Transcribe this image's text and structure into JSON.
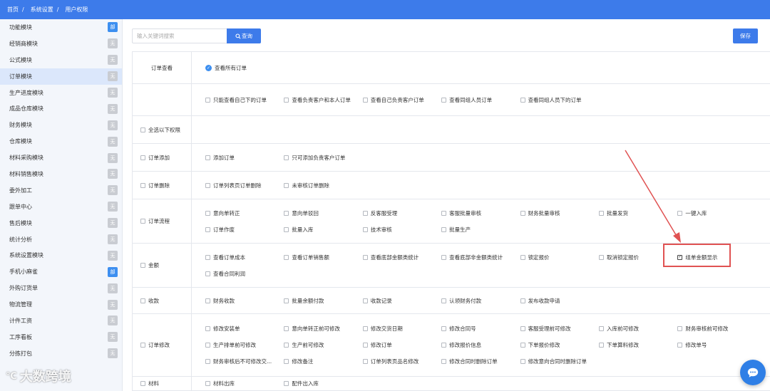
{
  "breadcrumb": [
    "首页",
    "系统设置",
    "用户权限"
  ],
  "breadcrumb_sep": "/",
  "sidebar": {
    "items": [
      {
        "label": "功能模块",
        "badge": "部",
        "badge_color": "#3d8ff0"
      },
      {
        "label": "经销商模块",
        "badge": "无"
      },
      {
        "label": "公式模块",
        "badge": "无"
      },
      {
        "label": "订单模块",
        "badge": "无",
        "active": true
      },
      {
        "label": "生产进度模块",
        "badge": "无"
      },
      {
        "label": "成品仓库模块",
        "badge": "无"
      },
      {
        "label": "财务模块",
        "badge": "无"
      },
      {
        "label": "仓库模块",
        "badge": "无"
      },
      {
        "label": "材料采购模块",
        "badge": "无"
      },
      {
        "label": "材料销售模块",
        "badge": "无"
      },
      {
        "label": "委外加工",
        "badge": "无"
      },
      {
        "label": "跟单中心",
        "badge": "无"
      },
      {
        "label": "售后模块",
        "badge": "无"
      },
      {
        "label": "统计分析",
        "badge": "无"
      },
      {
        "label": "系统设置模块",
        "badge": "无"
      },
      {
        "label": "手机小麻雀",
        "badge": "部",
        "badge_color": "#3d8ff0"
      },
      {
        "label": "外购订货单",
        "badge": "无"
      },
      {
        "label": "物流管理",
        "badge": "无"
      },
      {
        "label": "计件工资",
        "badge": "无"
      },
      {
        "label": "工序看板",
        "badge": "无"
      },
      {
        "label": "分拣打包",
        "badge": "无"
      }
    ]
  },
  "search": {
    "placeholder": "输入关键词搜索",
    "button_label": "查询",
    "button_icon": "search-icon"
  },
  "save_label": "保存",
  "permissions": [
    {
      "label": "订单查看",
      "options": [
        {
          "label": "查看所有订单",
          "radio": true,
          "checked": true
        }
      ]
    },
    {
      "label": "",
      "options": [
        {
          "label": "只能查看自己下的订单"
        },
        {
          "label": "查看负责客户和本人订单"
        },
        {
          "label": "查看自己负责客户订单"
        },
        {
          "label": "查看同组人员订单"
        },
        {
          "label": "查看同组人员下的订单"
        }
      ]
    },
    {
      "label": "全选以下权限",
      "label_checkbox": true,
      "options": []
    },
    {
      "label": "订单添加",
      "label_checkbox": true,
      "options": [
        {
          "label": "添加订单"
        },
        {
          "label": "只可添加负责客户订单"
        }
      ]
    },
    {
      "label": "订单删除",
      "label_checkbox": true,
      "options": [
        {
          "label": "订单列表页订单删除"
        },
        {
          "label": "未审核订单删除"
        }
      ]
    },
    {
      "label": "订单流程",
      "label_checkbox": true,
      "options": [
        {
          "label": "意向单转正"
        },
        {
          "label": "意向单驳回"
        },
        {
          "label": "反客服受理"
        },
        {
          "label": "客服批量审核"
        },
        {
          "label": "财务批量审核"
        },
        {
          "label": "批量发货"
        },
        {
          "label": "一键入库"
        },
        {
          "label": "订单作废"
        },
        {
          "label": "批量入库"
        },
        {
          "label": "技术审核"
        },
        {
          "label": "批量生产"
        }
      ]
    },
    {
      "label": "金额",
      "label_checkbox": true,
      "options": [
        {
          "label": "查看订单成本"
        },
        {
          "label": "查看订单销售额"
        },
        {
          "label": "查看底部金额类统计"
        },
        {
          "label": "查看底部非金额类统计"
        },
        {
          "label": "锁定报价"
        },
        {
          "label": "取消锁定报价"
        },
        {
          "label": "组单金额显示",
          "checked": true
        },
        {
          "label": "查看合同利润"
        }
      ]
    },
    {
      "label": "收款",
      "label_checkbox": true,
      "options": [
        {
          "label": "财务收款"
        },
        {
          "label": "批量余额付款"
        },
        {
          "label": "收款记录"
        },
        {
          "label": "认领财务付款"
        },
        {
          "label": "发布收款申请"
        }
      ]
    },
    {
      "label": "订单修改",
      "label_checkbox": true,
      "options": [
        {
          "label": "修改安装单"
        },
        {
          "label": "意向单转正前可修改"
        },
        {
          "label": "修改交货日期"
        },
        {
          "label": "修改合同号"
        },
        {
          "label": "客服受理前可修改"
        },
        {
          "label": "入库前可修改"
        },
        {
          "label": "财务审核前可修改"
        },
        {
          "label": "生产排单前可修改"
        },
        {
          "label": "生产前可修改"
        },
        {
          "label": "修改订单"
        },
        {
          "label": "修改报价信息"
        },
        {
          "label": "下单报价修改"
        },
        {
          "label": "下单算料修改"
        },
        {
          "label": "修改单号"
        },
        {
          "label": "财务审核后不可修改交..."
        },
        {
          "label": "修改备注"
        },
        {
          "label": "订单列表页品名修改"
        },
        {
          "label": "修改合同时删除订单"
        },
        {
          "label": "修改意向合同时删除订单"
        }
      ]
    },
    {
      "label": "材料",
      "label_checkbox": true,
      "options": [
        {
          "label": "材料出库"
        },
        {
          "label": "配件出入库"
        }
      ]
    }
  ],
  "watermark": {
    "mark": "℃",
    "text": "大数跨境"
  },
  "chat": {
    "icon": "chat-bubble-icon"
  },
  "colors": {
    "primary": "#3d7bea",
    "annotation": "#e05252",
    "badge_gray": "#c9ccd2"
  }
}
